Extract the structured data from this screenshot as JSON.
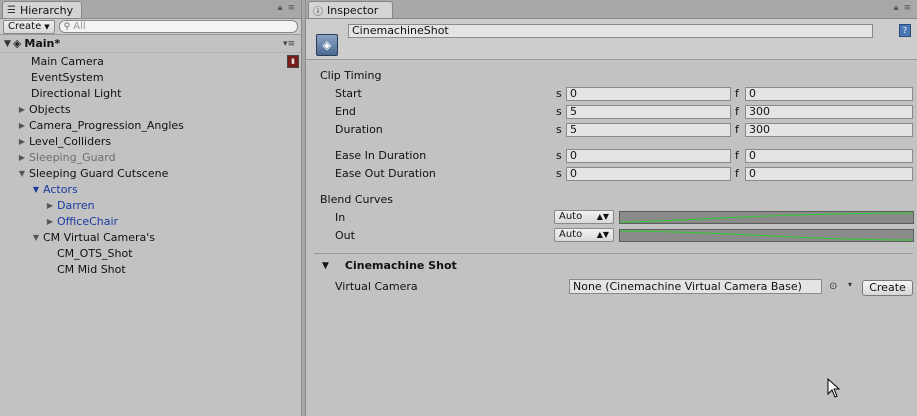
{
  "hierarchy": {
    "tab_title": "Hierarchy",
    "create_label": "Create",
    "search_placeholder": "All",
    "scene_name": "Main*",
    "items": [
      {
        "label": "Main Camera"
      },
      {
        "label": "EventSystem"
      },
      {
        "label": "Directional Light"
      },
      {
        "label": "Objects"
      },
      {
        "label": "Camera_Progression_Angles"
      },
      {
        "label": "Level_Colliders"
      },
      {
        "label": "Sleeping_Guard"
      },
      {
        "label": "Sleeping Guard Cutscene"
      },
      {
        "label": "Actors"
      },
      {
        "label": "Darren"
      },
      {
        "label": "OfficeChair"
      },
      {
        "label": "CM Virtual Camera's"
      },
      {
        "label": "CM_OTS_Shot"
      },
      {
        "label": "CM Mid Shot"
      }
    ]
  },
  "inspector": {
    "tab_title": "Inspector",
    "object_name": "CinemachineShot",
    "clip_timing": {
      "title": "Clip Timing",
      "s_unit": "s",
      "f_unit": "f",
      "rows": [
        {
          "label": "Start",
          "s": "0",
          "f": "0"
        },
        {
          "label": "End",
          "s": "5",
          "f": "300"
        },
        {
          "label": "Duration",
          "s": "5",
          "f": "300"
        },
        {
          "label": "Ease In Duration",
          "s": "0",
          "f": "0"
        },
        {
          "label": "Ease Out Duration",
          "s": "0",
          "f": "0"
        }
      ]
    },
    "blend_curves": {
      "title": "Blend Curves",
      "in_label": "In",
      "out_label": "Out",
      "in_mode": "Auto",
      "out_mode": "Auto",
      "curve_color": "#2ecc2e"
    },
    "cinemachine_shot": {
      "title": "Cinemachine Shot",
      "virtual_camera_label": "Virtual Camera",
      "virtual_camera_value": "None (Cinemachine Virtual Camera Base)",
      "create_label": "Create"
    }
  },
  "colors": {
    "panel_bg": "#c2c2c2",
    "tab_bar": "#a8a8a8",
    "prefab_blue": "#1b3aa0",
    "inactive_grey": "#6e6e6e"
  }
}
